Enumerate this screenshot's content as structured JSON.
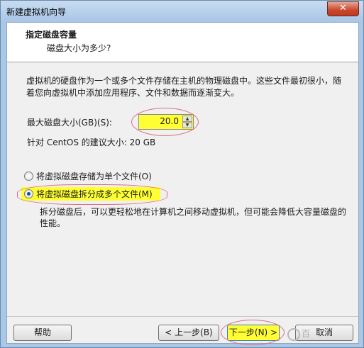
{
  "window": {
    "title": "新建虚拟机向导",
    "close_glyph": "✕"
  },
  "header": {
    "title": "指定磁盘容量",
    "subtitle": "磁盘大小为多少?"
  },
  "description": "虚拟机的硬盘作为一个或多个文件存储在主机的物理磁盘中。这些文件最初很小，随着您向虚拟机中添加应用程序、文件和数据而逐渐变大。",
  "max_disk": {
    "label": "最大磁盘大小(GB)(S):",
    "value": "20.0",
    "highlight_color": "#ffff33"
  },
  "recommend": "针对 CentOS 的建议大小: 20 GB",
  "options": [
    {
      "label": "将虚拟磁盘存储为单个文件(O)",
      "selected": false
    },
    {
      "label": "将虚拟磁盘拆分成多个文件(M)",
      "selected": true
    }
  ],
  "split_description": "拆分磁盘后，可以更轻松地在计算机之间移动虚拟机，但可能会降低大容量磁盘的性能。",
  "buttons": {
    "help": "帮助",
    "back": "< 上一步(B)",
    "next": "下一步(N) >",
    "cancel": "取消"
  },
  "watermark": "百"
}
